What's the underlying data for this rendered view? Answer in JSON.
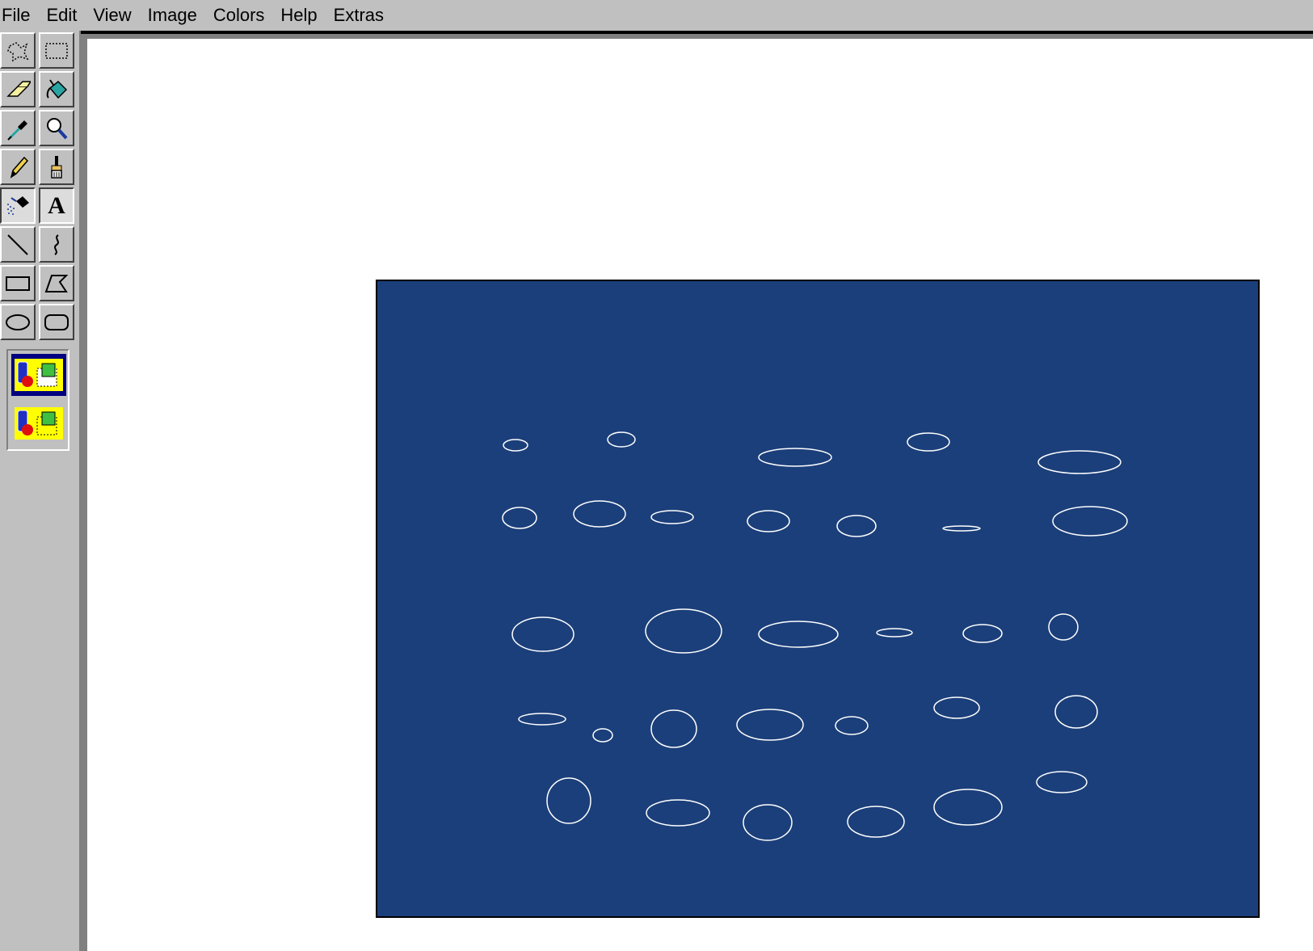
{
  "menu": {
    "items": [
      {
        "label": "File"
      },
      {
        "label": "Edit"
      },
      {
        "label": "View"
      },
      {
        "label": "Image"
      },
      {
        "label": "Colors"
      },
      {
        "label": "Help"
      },
      {
        "label": "Extras"
      }
    ]
  },
  "toolbox": {
    "tools": [
      {
        "name": "free-form-select-icon"
      },
      {
        "name": "rectangle-select-icon"
      },
      {
        "name": "eraser-icon"
      },
      {
        "name": "fill-bucket-icon"
      },
      {
        "name": "color-picker-icon"
      },
      {
        "name": "magnifier-icon"
      },
      {
        "name": "pencil-icon"
      },
      {
        "name": "brush-icon"
      },
      {
        "name": "airbrush-icon"
      },
      {
        "name": "text-icon",
        "glyph": "A"
      },
      {
        "name": "line-icon"
      },
      {
        "name": "curve-icon"
      },
      {
        "name": "rectangle-icon"
      },
      {
        "name": "polygon-icon"
      },
      {
        "name": "ellipse-icon"
      },
      {
        "name": "rounded-rectangle-icon"
      }
    ],
    "options": [
      "opaque-background-icon",
      "transparent-background-icon"
    ],
    "selected_option": 0
  },
  "canvas": {
    "background_color": "#ffffff",
    "shape_fill_color": "#1b3f7a",
    "ellipse_stroke_color": "#ffffff"
  }
}
